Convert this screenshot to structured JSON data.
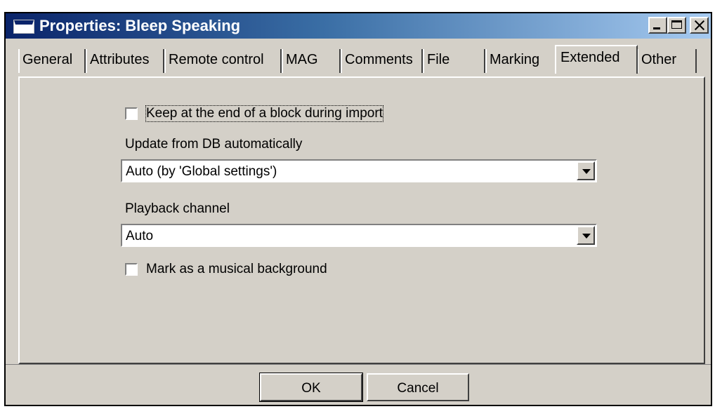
{
  "window": {
    "title": "Properties: Bleep Speaking"
  },
  "tabs": [
    {
      "label": "General"
    },
    {
      "label": "Attributes"
    },
    {
      "label": "Remote control"
    },
    {
      "label": "MAG"
    },
    {
      "label": "Comments"
    },
    {
      "label": "File"
    },
    {
      "label": "Marking"
    },
    {
      "label": "Extended",
      "active": true
    },
    {
      "label": "Other"
    }
  ],
  "extended": {
    "keep_at_end": {
      "label": "Keep at the end of a block during import",
      "checked": false
    },
    "update_from_db": {
      "label": "Update from DB automatically",
      "value": "Auto (by 'Global settings')"
    },
    "playback_channel": {
      "label": "Playback channel",
      "value": "Auto"
    },
    "musical_background": {
      "label": "Mark as a musical background",
      "checked": false
    }
  },
  "buttons": {
    "ok": "OK",
    "cancel": "Cancel"
  },
  "colors": {
    "title_start": "#0a246a",
    "title_end": "#a6caf0",
    "face": "#d4d0c8"
  }
}
